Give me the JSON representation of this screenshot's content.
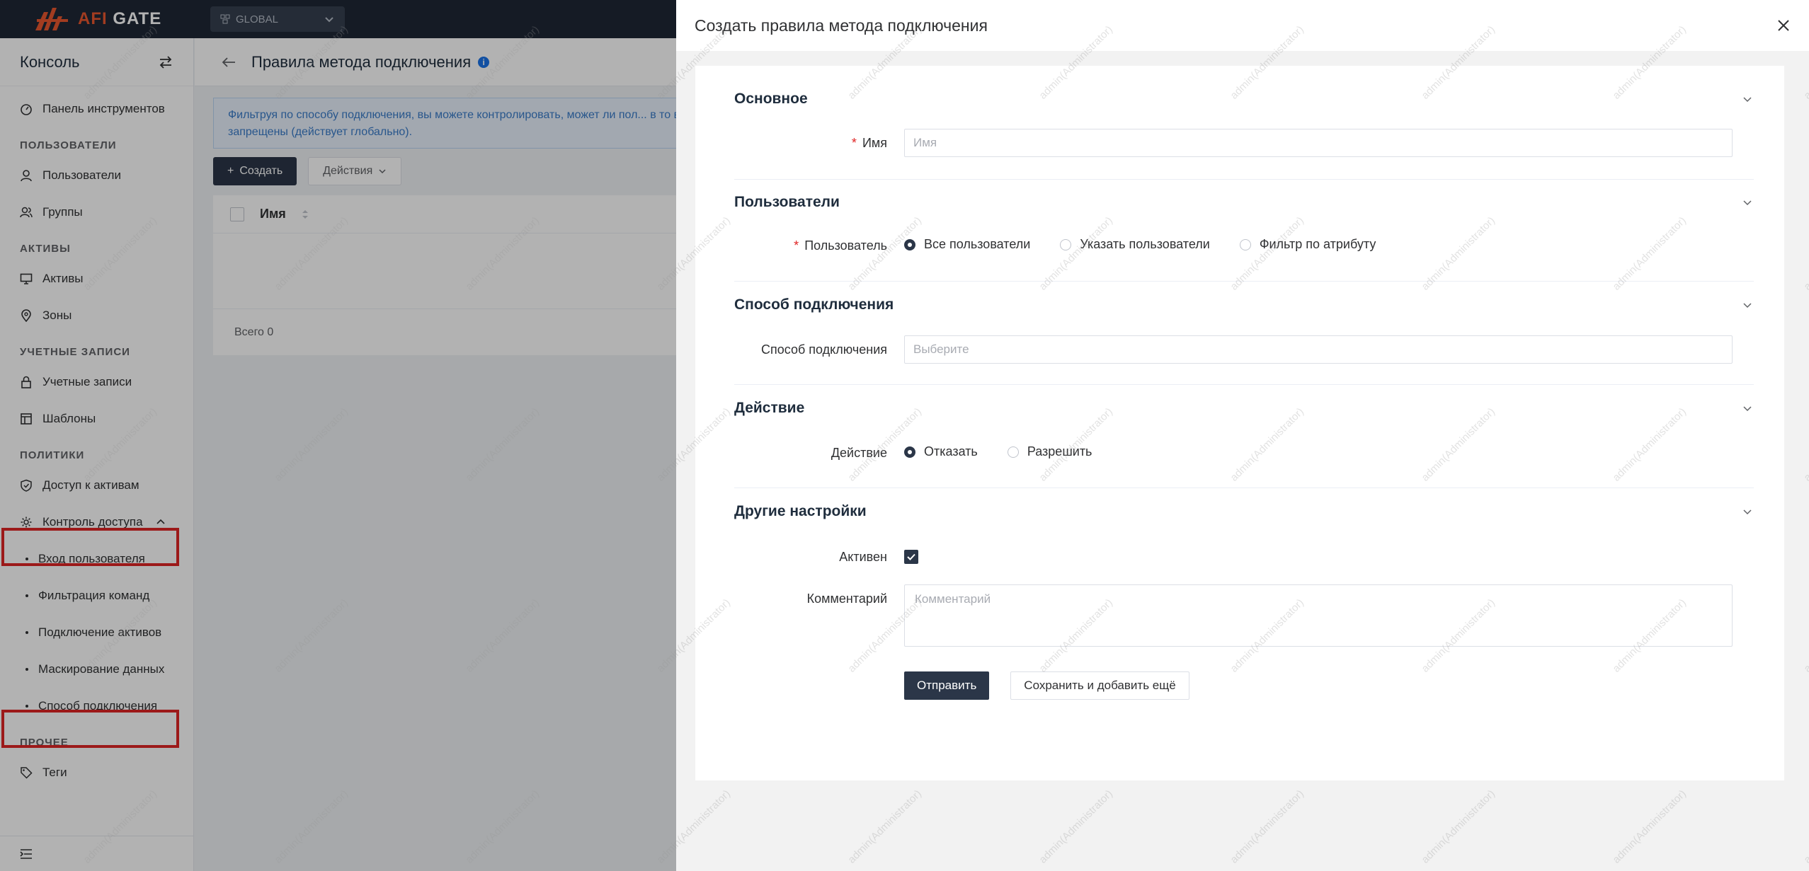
{
  "topbar": {
    "logo_prefix": "AFI",
    "logo_suffix": " GATE",
    "org_select": "GLOBAL"
  },
  "sidebar": {
    "title": "Консоль",
    "dashboard": "Панель инструментов",
    "group_users": "ПОЛЬЗОВАТЕЛИ",
    "users": "Пользователи",
    "groups": "Группы",
    "group_assets": "АКТИВЫ",
    "assets": "Активы",
    "zones": "Зоны",
    "group_accounts": "УЧЕТНЫЕ ЗАПИСИ",
    "accounts": "Учетные записи",
    "templates": "Шаблоны",
    "group_policies": "ПОЛИТИКИ",
    "asset_access": "Доступ к активам",
    "access_control": "Контроль доступа",
    "sub_items": [
      "Вход пользователя",
      "Фильтрация команд",
      "Подключение активов",
      "Маскирование данных",
      "Способ подключения"
    ],
    "group_other": "ПРОЧЕЕ",
    "tags": "Теги"
  },
  "page": {
    "title": "Правила метода подключения",
    "notice": "Фильтруя по способу подключения, вы можете контролировать, может ли пол... в то время как другие будут запрещены (действует глобально).",
    "create_button": "Создать",
    "actions_button": "Действия",
    "col_name": "Имя",
    "total": "Всего 0"
  },
  "drawer": {
    "title": "Создать правила метода подключения",
    "sections": {
      "basic": "Основное",
      "users": "Пользователи",
      "connect_method": "Способ подключения",
      "action": "Действие",
      "other": "Другие настройки"
    },
    "name_label": "Имя",
    "name_placeholder": "Имя",
    "user_label": "Пользователь",
    "user_options": [
      "Все пользователи",
      "Указать пользователи",
      "Фильтр по атрибуту"
    ],
    "connect_label": "Способ подключения",
    "connect_placeholder": "Выберите",
    "action_label": "Действие",
    "action_options": [
      "Отказать",
      "Разрешить"
    ],
    "active_label": "Активен",
    "comment_label": "Комментарий",
    "comment_placeholder": "Комментарий",
    "submit_button": "Отправить",
    "save_add_button": "Сохранить и добавить ещё"
  },
  "watermark": "admin(Administrator)",
  "colors": {
    "topbar": "#1f2836",
    "primary_button": "#2b3648",
    "highlight": "#e02424",
    "logo_accent": "#e8572f"
  }
}
